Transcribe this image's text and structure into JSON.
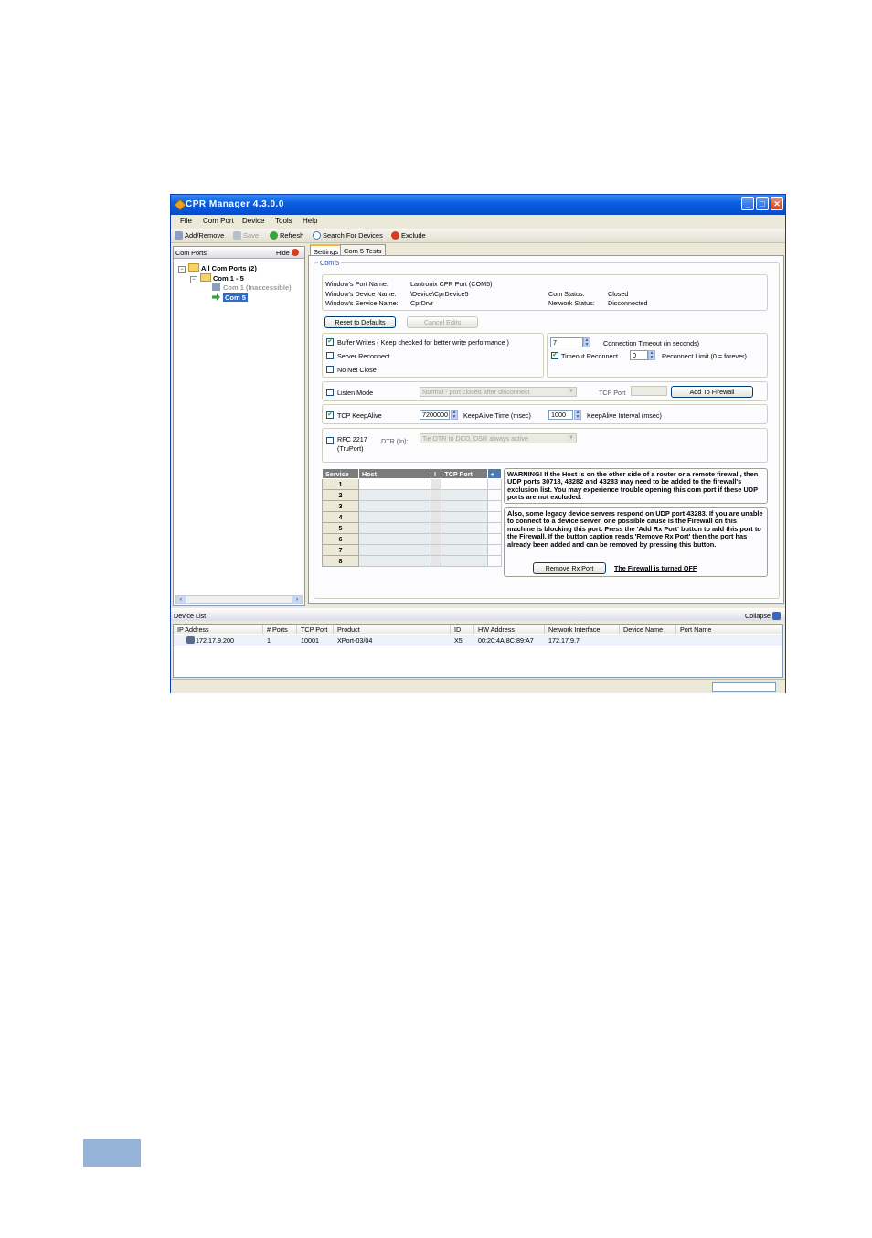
{
  "window": {
    "title": "CPR Manager 4.3.0.0",
    "min": "_",
    "max": "□",
    "close": "✕"
  },
  "menu": [
    "File",
    "Com Port",
    "Device",
    "Tools",
    "Help"
  ],
  "toolbar": {
    "add_remove": "Add/Remove",
    "save": "Save",
    "refresh": "Refresh",
    "search": "Search For Devices",
    "exclude": "Exclude"
  },
  "left": {
    "header": "Com Ports",
    "hide": "Hide",
    "tree": {
      "root": "All Com Ports (2)",
      "group": "Com 1 - 5",
      "item1": "Com 1 (Inaccessible)",
      "item2": "Com 5"
    }
  },
  "tabs": [
    "Settings",
    "Com 5 Tests"
  ],
  "settings": {
    "group_title": "Com 5",
    "info": {
      "port_name_label": "Window's Port Name:",
      "port_name": "Lantronix CPR Port (COM5)",
      "device_name_label": "Window's Device Name:",
      "device_name": "\\Device\\CprDevice5",
      "service_name_label": "Window's Service Name:",
      "service_name": "CprDrvr",
      "com_status_label": "Com Status:",
      "com_status": "Closed",
      "network_status_label": "Network Status:",
      "network_status": "Disconnected"
    },
    "reset": "Reset to Defaults",
    "cancel": "Cancel Edits",
    "buffer_writes": "Buffer Writes    ( Keep checked for better write performance )",
    "server_reconnect": "Server Reconnect",
    "no_net_close": "No Net Close",
    "connection_timeout_value": "7",
    "connection_timeout_label": "Connection Timeout (in seconds)",
    "timeout_reconnect": "Timeout Reconnect",
    "reconnect_limit_value": "0",
    "reconnect_limit_label": "Reconnect Limit (0 = forever)",
    "listen_mode": "Listen Mode",
    "listen_mode_option": "Normal - port closed after disconnect",
    "tcp_port_label": "TCP Port",
    "add_to_firewall": "Add To Firewall",
    "tcp_keepalive": "TCP KeepAlive",
    "keepalive_time_value": "7200000",
    "keepalive_time_label": "KeepAlive Time (msec)",
    "keepalive_interval_value": "1000",
    "keepalive_interval_label": "KeepAlive Interval (msec)",
    "rfc_label_1": "RFC 2217",
    "rfc_label_2": "(TruPort)",
    "dtr_label": "DTR (In):",
    "dtr_option": "Tie DTR to DCD, DSR always active",
    "grid_headers": [
      "Service",
      "Host",
      "I",
      "TCP Port"
    ],
    "grid_rows": [
      "1",
      "2",
      "3",
      "4",
      "5",
      "6",
      "7",
      "8"
    ],
    "warning": "WARNING!   If the Host is on the other side of a router or a remote firewall, then UDP ports 30718, 43282 and 43283 may need to be added to the firewall's exclusion list.  You may experience trouble opening this com port if these UDP ports are not excluded.",
    "also": "Also, some legacy device servers respond on UDP port 43283.  If you are unable to connect to a device server, one possible cause is the Firewall on this machine is blocking this port.  Press the 'Add Rx Port' button to add this port to the Firewall.   If the button caption reads 'Remove Rx Port' then the port has already been added and can be removed by pressing this button.",
    "remove_rx": "Remove Rx Port",
    "firewall_status": "The Firewall is turned OFF"
  },
  "device_list": {
    "title": "Device List",
    "collapse": "Collapse",
    "columns": [
      "IP Address",
      "# Ports",
      "TCP Port",
      "Product",
      "ID",
      "HW Address",
      "Network Interface",
      "Device Name",
      "Port Name"
    ],
    "rows": [
      [
        "172.17.9.200",
        "1",
        "10001",
        "XPort-03/04",
        "X5",
        "00:20:4A:8C:89:A7",
        "172.17.9.7",
        "",
        ""
      ]
    ]
  },
  "colors": {
    "titlebar": "#0a5fe0",
    "accent_tab": "#f6b63c",
    "footer_block": "#95b3d7"
  }
}
